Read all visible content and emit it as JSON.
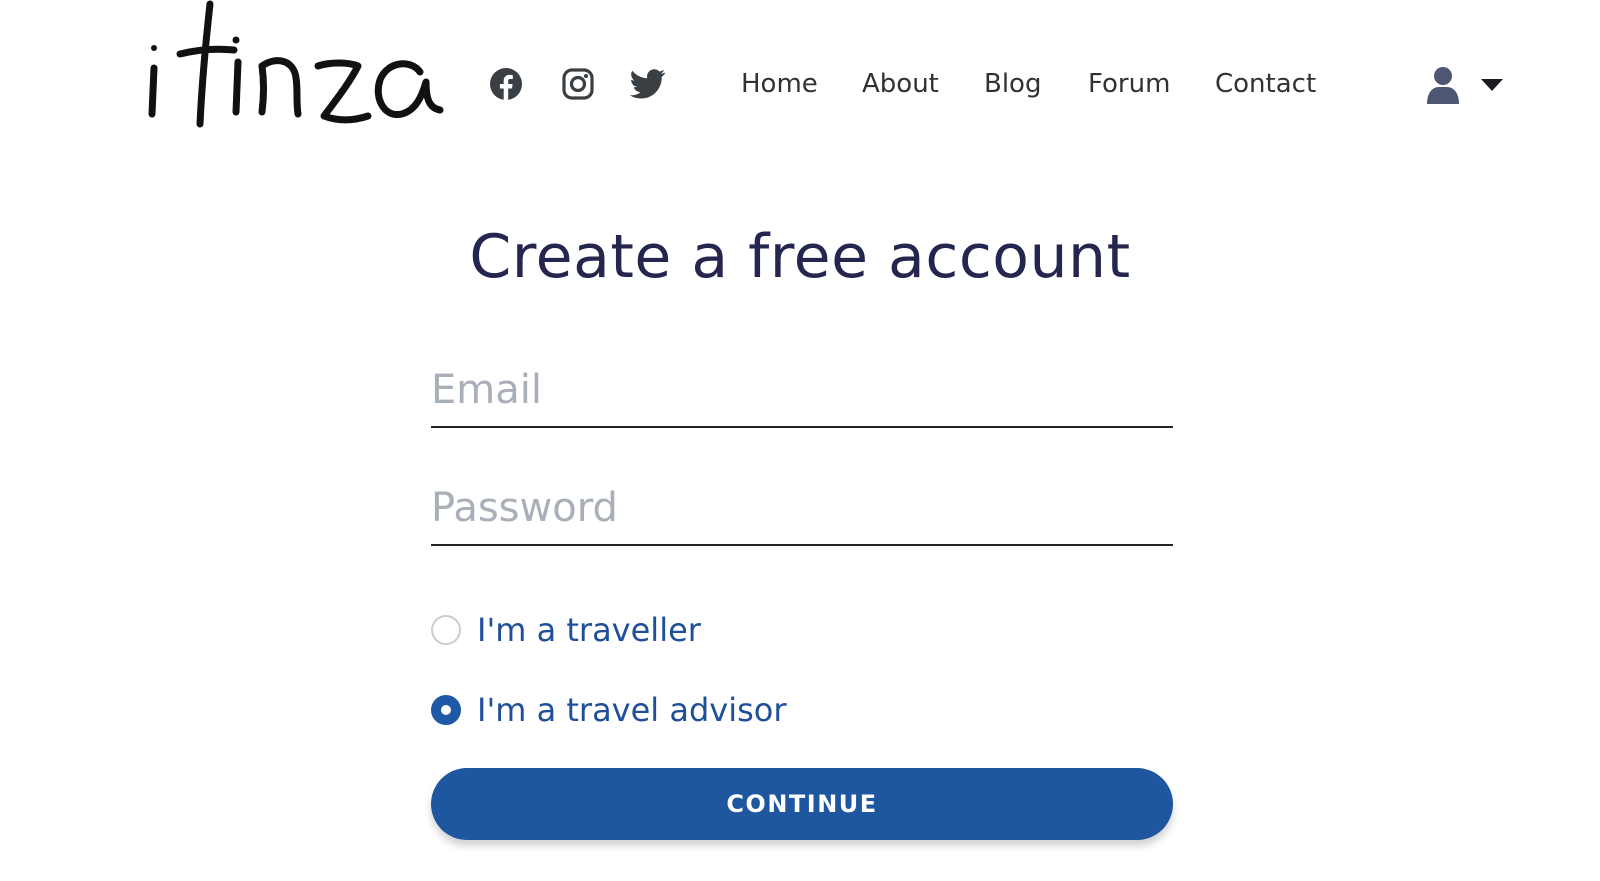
{
  "brand": {
    "logo_text": "itinza"
  },
  "social": [
    {
      "name": "facebook-icon"
    },
    {
      "name": "instagram-icon"
    },
    {
      "name": "twitter-icon"
    }
  ],
  "nav": {
    "items": [
      {
        "label": "Home"
      },
      {
        "label": "About"
      },
      {
        "label": "Blog"
      },
      {
        "label": "Forum"
      },
      {
        "label": "Contact"
      }
    ]
  },
  "account_menu": {
    "icons": [
      "user-icon",
      "caret-down-icon"
    ]
  },
  "form": {
    "title": "Create a free account",
    "email": {
      "placeholder": "Email",
      "value": ""
    },
    "password": {
      "placeholder": "Password",
      "value": ""
    },
    "roles": [
      {
        "label": "I'm a traveller",
        "selected": false
      },
      {
        "label": "I'm a travel advisor",
        "selected": true
      }
    ],
    "continue_label": "CONTINUE"
  },
  "colors": {
    "primary": "#1f56a0",
    "title": "#24264f",
    "radio_label": "#1f4f99",
    "placeholder": "#a9afb8",
    "icon": "#3a3f44",
    "user_icon": "#4d5773"
  }
}
